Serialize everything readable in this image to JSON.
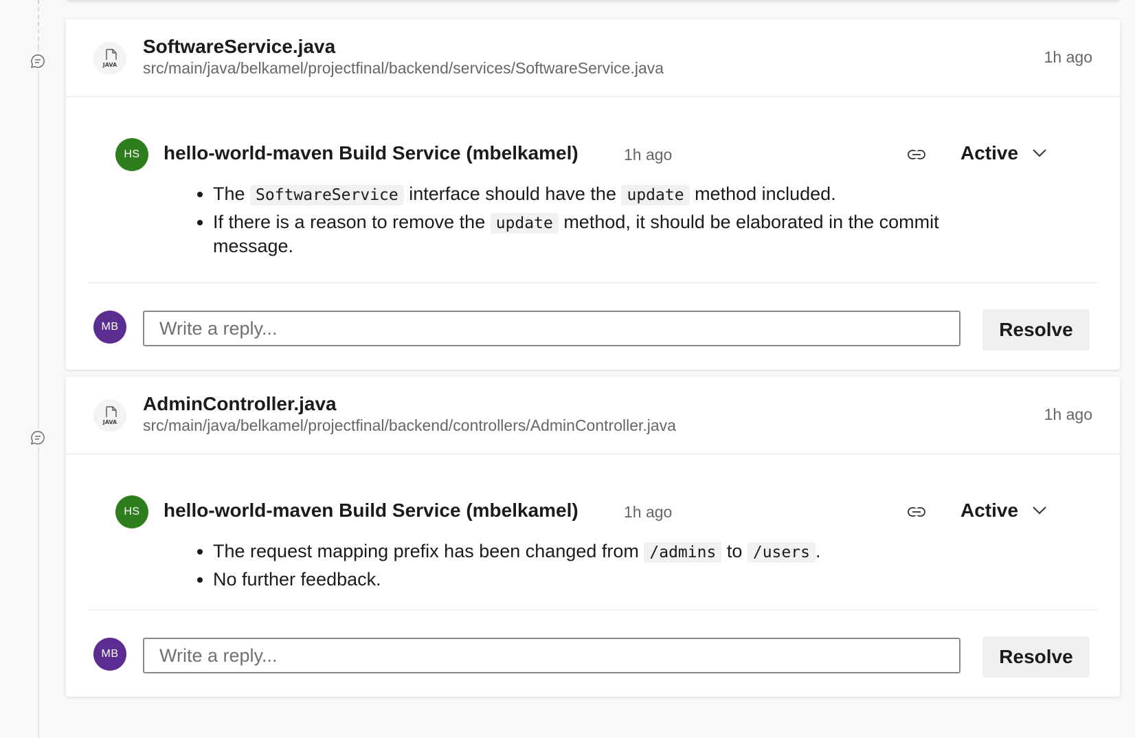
{
  "threads": [
    {
      "file_icon_label": "JAVA",
      "file_name": "SoftwareService.java",
      "file_path": "src/main/java/belkamel/projectfinal/backend/services/SoftwareService.java",
      "time": "1h ago",
      "comment": {
        "avatar_initials": "HS",
        "author": "hello-world-maven Build Service (mbelkamel)",
        "time": "1h ago",
        "status": "Active",
        "bullets": [
          [
            {
              "text": "The "
            },
            {
              "code": "SoftwareService"
            },
            {
              "text": " interface should have the "
            },
            {
              "code": "update"
            },
            {
              "text": " method included."
            }
          ],
          [
            {
              "text": "If there is a reason to remove the "
            },
            {
              "code": "update"
            },
            {
              "text": " method, it should be elaborated in the commit message."
            }
          ]
        ]
      },
      "reply": {
        "avatar_initials": "MB",
        "placeholder": "Write a reply...",
        "resolve_label": "Resolve"
      }
    },
    {
      "file_icon_label": "JAVA",
      "file_name": "AdminController.java",
      "file_path": "src/main/java/belkamel/projectfinal/backend/controllers/AdminController.java",
      "time": "1h ago",
      "comment": {
        "avatar_initials": "HS",
        "author": "hello-world-maven Build Service (mbelkamel)",
        "time": "1h ago",
        "status": "Active",
        "bullets": [
          [
            {
              "text": "The request mapping prefix has been changed from "
            },
            {
              "code": "/admins"
            },
            {
              "text": " to "
            },
            {
              "code": "/users"
            },
            {
              "text": "."
            }
          ],
          [
            {
              "text": "No further feedback."
            }
          ]
        ]
      },
      "reply": {
        "avatar_initials": "MB",
        "placeholder": "Write a reply...",
        "resolve_label": "Resolve"
      }
    }
  ],
  "icons": {
    "timeline": "comment-bubble-icon",
    "file": "java-file-icon",
    "link": "link-icon",
    "status_dropdown": "chevron-down-icon"
  },
  "colors": {
    "avatar_hs": "#2e7d1f",
    "avatar_mb": "#5c2d91",
    "background": "#f8f8f8"
  }
}
